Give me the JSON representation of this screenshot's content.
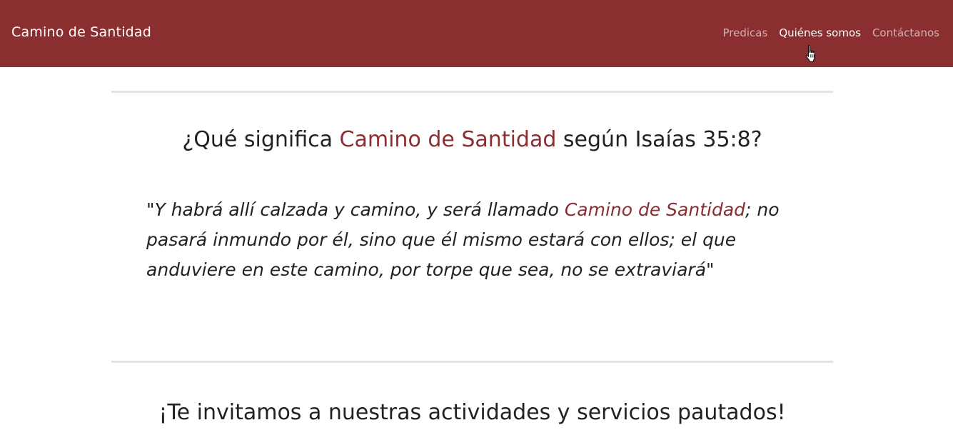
{
  "navbar": {
    "brand": "Camino de Santidad",
    "links": [
      {
        "label": "Predicas"
      },
      {
        "label": "Quiénes somos"
      },
      {
        "label": "Contáctanos"
      }
    ]
  },
  "section1": {
    "heading_before": "¿Qué significa ",
    "heading_highlight": "Camino de Santidad",
    "heading_after": " según Isaías 35:8?",
    "quote_before": "\"Y habrá allí calzada y camino, y será llamado ",
    "quote_highlight": "Camino de Santidad",
    "quote_after": "; no pasará inmundo por él, sino que él mismo estará con ellos; el que anduviere en este camino, por torpe que sea, no se extraviará\""
  },
  "section2": {
    "heading": "¡Te invitamos a nuestras actividades y servicios pautados!"
  },
  "colors": {
    "brand": "#8b2e30",
    "divider": "#e3e3e3",
    "text": "#222222"
  },
  "icons": {
    "cursor": "hand-pointer-icon"
  }
}
